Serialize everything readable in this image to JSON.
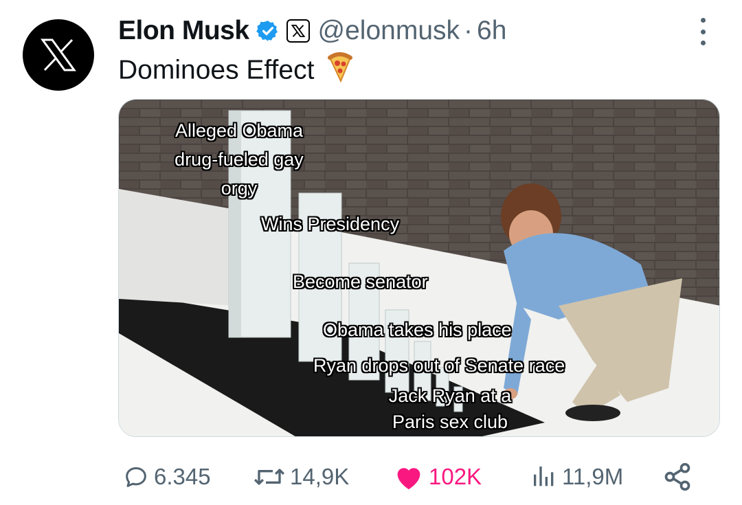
{
  "author": {
    "name": "Elon Musk",
    "handle": "@elonmusk",
    "separator": "·",
    "time": "6h"
  },
  "tweet": {
    "text": "Dominoes Effect",
    "emoji": "🍕"
  },
  "media": {
    "captions": [
      "Alleged Obama",
      "drug-fueled gay",
      "orgy",
      "Wins Presidency",
      "Become senator",
      "Obama takes his place",
      "Ryan drops out of Senate race",
      "Jack Ryan at a",
      "Paris sex club"
    ]
  },
  "actions": {
    "replies": "6.345",
    "reposts": "14,9K",
    "likes": "102K",
    "views": "11,9M"
  },
  "colors": {
    "verified": "#1d9bf0",
    "like": "#f91880",
    "muted": "#536471"
  }
}
